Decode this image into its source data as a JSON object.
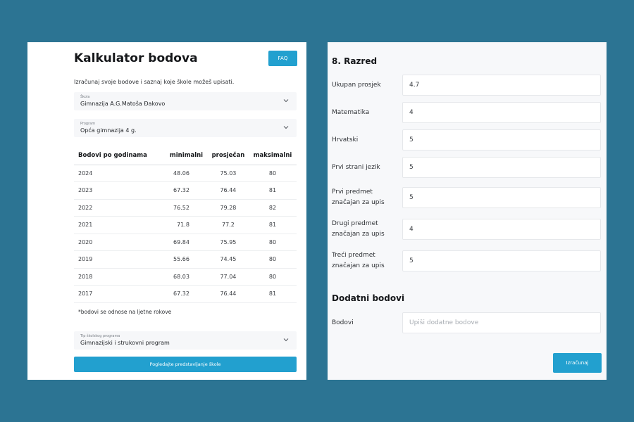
{
  "left": {
    "title": "Kalkulator bodova",
    "faq_label": "FAQ",
    "subtitle": "Izračunaj svoje bodove i saznaj koje škole možeš upisati.",
    "school": {
      "label": "Škola",
      "value": "Gimnazija A.G.Matoša Đakovo"
    },
    "program": {
      "label": "Program",
      "value": "Opća gimnazija 4 g."
    },
    "table": {
      "headers": [
        "Bodovi po godinama",
        "minimalni",
        "prosječan",
        "maksimalni"
      ],
      "rows": [
        [
          "2024",
          "48.06",
          "75.03",
          "80"
        ],
        [
          "2023",
          "67.32",
          "76.44",
          "81"
        ],
        [
          "2022",
          "76.52",
          "79.28",
          "82"
        ],
        [
          "2021",
          "71.8",
          "77.2",
          "81"
        ],
        [
          "2020",
          "69.84",
          "75.95",
          "80"
        ],
        [
          "2019",
          "55.66",
          "74.45",
          "80"
        ],
        [
          "2018",
          "68.03",
          "77.04",
          "80"
        ],
        [
          "2017",
          "67.32",
          "76.44",
          "81"
        ]
      ]
    },
    "note": "*bodovi se odnose na ljetne rokove",
    "program_type": {
      "label": "Tip školskog programa",
      "value": "Gimnazijski i strukovni program"
    },
    "cta_label": "Pogledajte predstavljanje škole"
  },
  "right": {
    "grade_title": "8. Razred",
    "fields": [
      {
        "label": "Ukupan prosjek",
        "value": "4.7"
      },
      {
        "label": "Matematika",
        "value": "4"
      },
      {
        "label": "Hrvatski",
        "value": "5"
      },
      {
        "label": "Prvi strani jezik",
        "value": "5"
      },
      {
        "label": "Prvi predmet značajan za upis",
        "value": "5"
      },
      {
        "label": "Drugi predmet značajan za upis",
        "value": "4"
      },
      {
        "label": "Treći predmet značajan za upis",
        "value": "5"
      }
    ],
    "extra_title": "Dodatni bodovi",
    "extra_field": {
      "label": "Bodovi",
      "placeholder": "Upiši dodatne bodove"
    },
    "calc_label": "Izračunaj"
  },
  "colors": {
    "background": "#2c7493",
    "accent": "#22a0cf"
  },
  "icons": {
    "dropdown": "chevron-down-icon"
  }
}
